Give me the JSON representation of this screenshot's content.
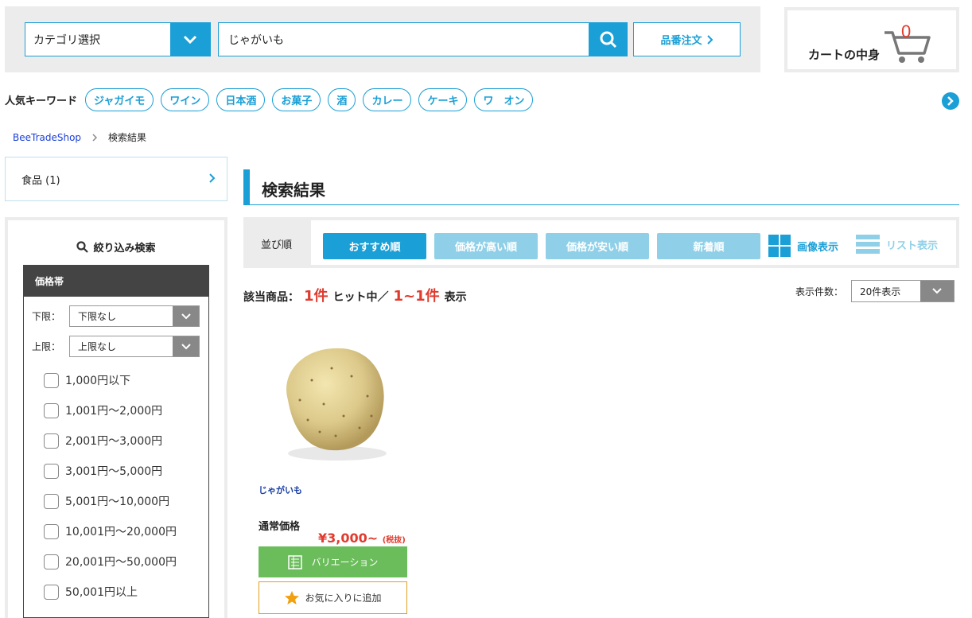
{
  "header": {
    "category_select": "カテゴリ選択",
    "search_value": "じゃがいも",
    "order_button": "品番注文",
    "cart_label": "カートの中身",
    "cart_count": "0"
  },
  "keywords": {
    "title": "人気キーワード",
    "items": [
      "ジャガイモ",
      "ワイン",
      "日本酒",
      "お菓子",
      "酒",
      "カレー",
      "ケーキ",
      "ワ　オン"
    ]
  },
  "breadcrumb": {
    "home": "BeeTradeShop",
    "current": "検索結果"
  },
  "sidebar": {
    "category": "食品 (1)",
    "filter_title": "絞り込み検索",
    "price_band": "価格帯",
    "lower_label": "下限：",
    "lower_value": "下限なし",
    "upper_label": "上限：",
    "upper_value": "上限なし",
    "price_options": [
      "1,000円以下",
      "1,001円～2,000円",
      "2,001円～3,000円",
      "3,001円～5,000円",
      "5,001円～10,000円",
      "10,001円～20,000円",
      "20,001円～50,000円",
      "50,001円以上"
    ]
  },
  "main": {
    "title": "検索結果",
    "sort_label": "並び順",
    "sort_options": [
      "おすすめ順",
      "価格が高い順",
      "価格が安い順",
      "新着順"
    ],
    "view_image": "画像表示",
    "view_list": "リスト表示",
    "hits_prefix": "該当商品：",
    "hits_count": "1件",
    "hits_mid": "ヒット中／",
    "hits_range": "1~1件",
    "hits_suffix": "表示",
    "per_page_label": "表示件数：",
    "per_page_value": "20件表示"
  },
  "product": {
    "name": "じゃがいも",
    "price_label": "通常価格",
    "price": "¥3,000~",
    "tax": "(税抜)",
    "variation_button": "バリエーション",
    "favorite_button": "お気に入りに追加"
  },
  "colors": {
    "accent": "#1a9fd6",
    "sale_red": "#e03b2e",
    "sort_inactive": "#8fd0e8",
    "variation_green": "#6bbd5b"
  }
}
